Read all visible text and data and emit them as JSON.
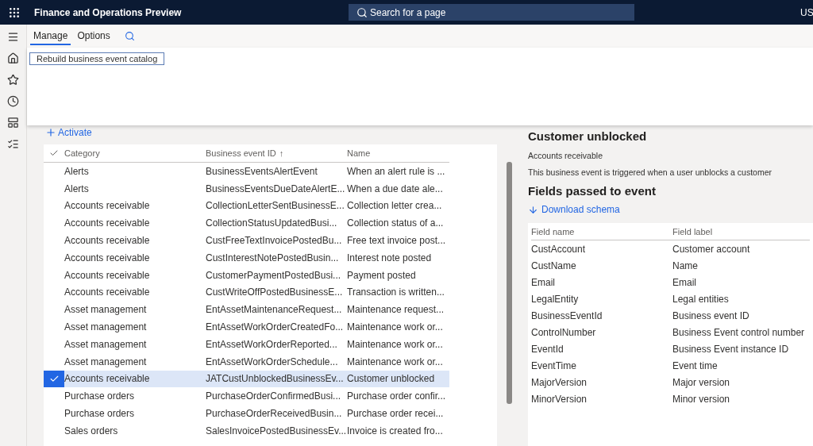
{
  "header": {
    "title": "Finance and Operations Preview",
    "search": {
      "placeholder": "Search for a page"
    },
    "company": "US"
  },
  "ribbon": {
    "tabs": [
      {
        "label": "Manage",
        "selected": true
      },
      {
        "label": "Options",
        "selected": false
      }
    ],
    "actions": [
      "Rebuild business event catalog"
    ]
  },
  "toolbar": {
    "activate": "Activate"
  },
  "grid": {
    "columns": [
      "Category",
      "Business event ID",
      "Name"
    ],
    "sort_arrow": "↑",
    "rows": [
      {
        "category": "Alerts",
        "id": "BusinessEventsAlertEvent",
        "name": "When an alert rule is ...",
        "selected": false
      },
      {
        "category": "Alerts",
        "id": "BusinessEventsDueDateAlertE...",
        "name": "When a due date ale...",
        "selected": false
      },
      {
        "category": "Accounts receivable",
        "id": "CollectionLetterSentBusinessE...",
        "name": "Collection letter crea...",
        "selected": false
      },
      {
        "category": "Accounts receivable",
        "id": "CollectionStatusUpdatedBusi...",
        "name": "Collection status of a...",
        "selected": false
      },
      {
        "category": "Accounts receivable",
        "id": "CustFreeTextInvoicePostedBu...",
        "name": "Free text invoice post...",
        "selected": false
      },
      {
        "category": "Accounts receivable",
        "id": "CustInterestNotePostedBusin...",
        "name": "Interest note posted",
        "selected": false
      },
      {
        "category": "Accounts receivable",
        "id": "CustomerPaymentPostedBusi...",
        "name": "Payment posted",
        "selected": false
      },
      {
        "category": "Accounts receivable",
        "id": "CustWriteOffPostedBusinessE...",
        "name": "Transaction is written...",
        "selected": false
      },
      {
        "category": "Asset management",
        "id": "EntAssetMaintenanceRequest...",
        "name": "Maintenance request...",
        "selected": false
      },
      {
        "category": "Asset management",
        "id": "EntAssetWorkOrderCreatedFo...",
        "name": "Maintenance work or...",
        "selected": false
      },
      {
        "category": "Asset management",
        "id": "EntAssetWorkOrderReported...",
        "name": "Maintenance work or...",
        "selected": false
      },
      {
        "category": "Asset management",
        "id": "EntAssetWorkOrderSchedule...",
        "name": "Maintenance work or...",
        "selected": false
      },
      {
        "category": "Accounts receivable",
        "id": "JATCustUnblockedBusinessEv...",
        "name": "Customer unblocked",
        "selected": true
      },
      {
        "category": "Purchase orders",
        "id": "PurchaseOrderConfirmedBusi...",
        "name": "Purchase order confir...",
        "selected": false
      },
      {
        "category": "Purchase orders",
        "id": "PurchaseOrderReceivedBusin...",
        "name": "Purchase order recei...",
        "selected": false
      },
      {
        "category": "Sales orders",
        "id": "SalesInvoicePostedBusinessEv...",
        "name": "Invoice is created fro...",
        "selected": false
      }
    ]
  },
  "details": {
    "title": "Customer unblocked",
    "category": "Accounts receivable",
    "description": "This business event is triggered when a user unblocks a customer",
    "fields_heading": "Fields passed to event",
    "download": "Download schema",
    "columns": [
      "Field name",
      "Field label"
    ],
    "fields": [
      {
        "name": "CustAccount",
        "label": "Customer account"
      },
      {
        "name": "CustName",
        "label": "Name"
      },
      {
        "name": "Email",
        "label": "Email"
      },
      {
        "name": "LegalEntity",
        "label": "Legal entities"
      },
      {
        "name": "BusinessEventId",
        "label": "Business event ID"
      },
      {
        "name": "ControlNumber",
        "label": "Business Event control number"
      },
      {
        "name": "EventId",
        "label": "Business Event instance ID"
      },
      {
        "name": "EventTime",
        "label": "Event time"
      },
      {
        "name": "MajorVersion",
        "label": "Major version"
      },
      {
        "name": "MinorVersion",
        "label": "Minor version"
      }
    ]
  }
}
